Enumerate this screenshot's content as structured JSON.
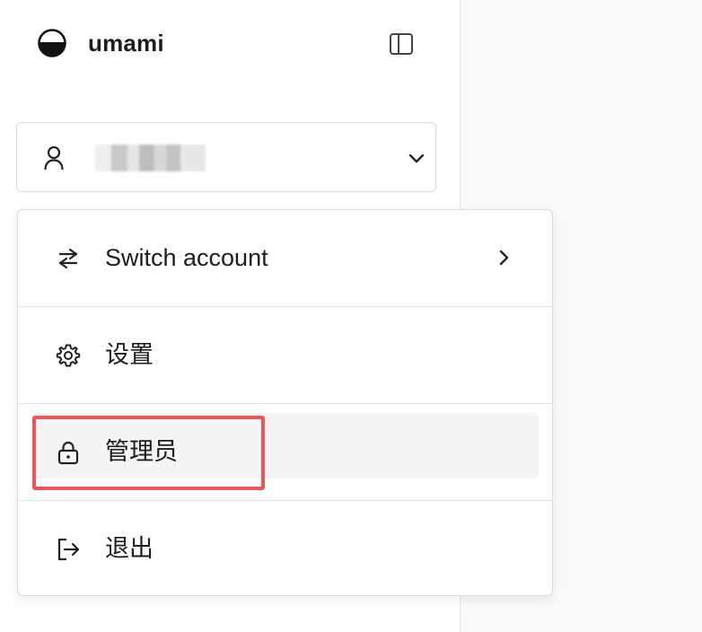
{
  "brand": {
    "name": "umami",
    "logo_icon": "half-circle-logo-icon",
    "collapse_icon": "sidebar-toggle-icon"
  },
  "account": {
    "username": " ",
    "user_icon": "user-icon",
    "chevron_icon": "chevron-down-icon"
  },
  "menu": {
    "items": [
      {
        "label": "Switch account",
        "icon": "switch-arrows-icon",
        "right_icon": "chevron-right-icon"
      },
      {
        "label": "设置",
        "icon": "gear-icon"
      },
      {
        "label": "管理员",
        "icon": "lock-icon",
        "highlighted": true
      },
      {
        "label": "退出",
        "icon": "logout-icon"
      }
    ]
  },
  "colors": {
    "highlight_border": "#f0545a",
    "active_item_bg": "#f5f5f5",
    "main_area_bg": "#f9f9f9",
    "border": "#dcdcdc"
  }
}
